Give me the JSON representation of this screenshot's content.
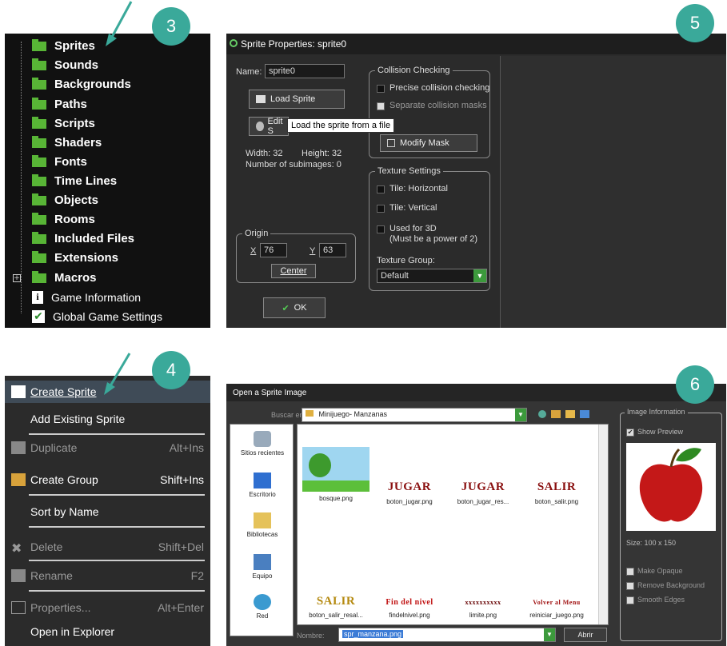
{
  "badges": [
    "3",
    "5",
    "4",
    "6"
  ],
  "resource_tree": {
    "items": [
      "Sprites",
      "Sounds",
      "Backgrounds",
      "Paths",
      "Scripts",
      "Shaders",
      "Fonts",
      "Time Lines",
      "Objects",
      "Rooms",
      "Included Files",
      "Extensions",
      "Macros"
    ],
    "extra_items": [
      "Game Information",
      "Global Game Settings"
    ],
    "folder_color": "#58b536"
  },
  "sprite_properties": {
    "title": "Sprite Properties: sprite0",
    "name_label": "Name:",
    "name_value": "sprite0",
    "load_button": "Load Sprite",
    "edit_button": "Edit S",
    "tooltip": "Load the sprite from a file",
    "width_text": "Width: 32",
    "height_text": "Height: 32",
    "subimages_text": "Number of subimages: 0",
    "origin_label": "Origin",
    "x_label": "X",
    "x_value": "76",
    "y_label": "Y",
    "y_value": "63",
    "center_button": "Center",
    "ok_button": "OK",
    "collision_group": "Collision Checking",
    "precise_label": "Precise collision checking",
    "separate_label": "Separate collision masks",
    "modify_mask_button": "Modify Mask",
    "texture_group": "Texture Settings",
    "tile_h": "Tile: Horizontal",
    "tile_v": "Tile: Vertical",
    "used_3d": "Used for 3D",
    "power2": "(Must be a power of 2)",
    "texture_group_label": "Texture Group:",
    "texture_group_value": "Default"
  },
  "context_menu": {
    "items": [
      {
        "label": "Create Sprite",
        "shortcut": ""
      },
      {
        "label": "Add Existing Sprite",
        "shortcut": ""
      },
      {
        "label": "Duplicate",
        "shortcut": "Alt+Ins"
      },
      {
        "label": "Create Group",
        "shortcut": "Shift+Ins"
      },
      {
        "label": "Sort by Name",
        "shortcut": ""
      },
      {
        "label": "Delete",
        "shortcut": "Shift+Del"
      },
      {
        "label": "Rename",
        "shortcut": "F2"
      },
      {
        "label": "Properties...",
        "shortcut": "Alt+Enter"
      },
      {
        "label": "Open in Explorer",
        "shortcut": ""
      }
    ]
  },
  "open_dialog": {
    "title": "Open a Sprite Image",
    "look_in_label": "Buscar en:",
    "folder": "Minijuego- Manzanas",
    "places": [
      "Sitios recientes",
      "Escritorio",
      "Bibliotecas",
      "Equipo",
      "Red"
    ],
    "files": [
      {
        "name": "bosque.png",
        "thumb": ""
      },
      {
        "name": "boton_jugar.png",
        "thumb": "JUGAR"
      },
      {
        "name": "boton_jugar_res...",
        "thumb": "JUGAR"
      },
      {
        "name": "boton_salir.png",
        "thumb": "SALIR"
      },
      {
        "name": "boton_salir_resal...",
        "thumb": "SALIR"
      },
      {
        "name": "findelnivel.png",
        "thumb": "Fin del nivel"
      },
      {
        "name": "limite.png",
        "thumb": "xxxxxxxxxx"
      },
      {
        "name": "reiniciar_juego.png",
        "thumb": "Volver al Menu"
      }
    ],
    "name_label": "Nombre:",
    "name_value": "spr_manzana.png",
    "open_button": "Abrir",
    "info_group": "Image Information",
    "show_preview": "Show Preview",
    "size_text": "Size: 100 x 150",
    "make_opaque": "Make Opaque",
    "remove_bg": "Remove Background",
    "smooth_edges": "Smooth Edges"
  }
}
